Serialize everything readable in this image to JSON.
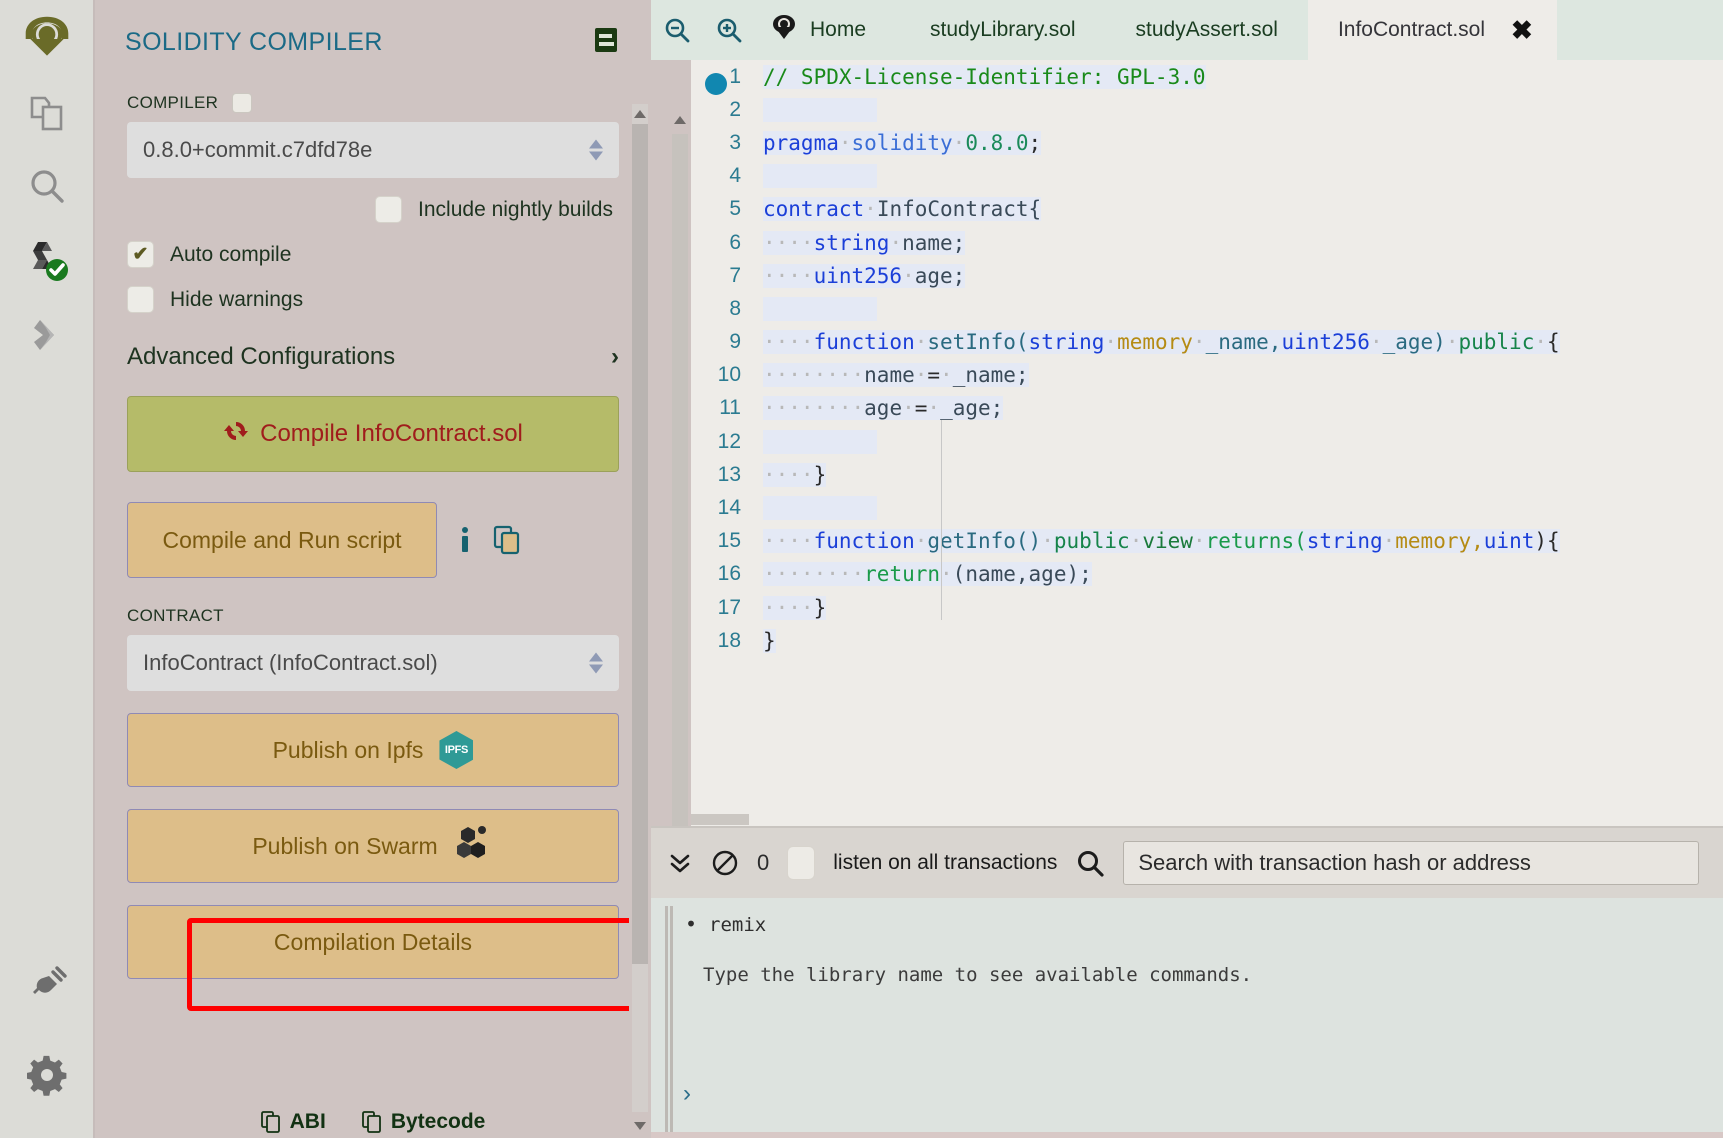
{
  "rail": {
    "items": [
      {
        "name": "remix-logo-icon",
        "label": "Remix"
      },
      {
        "name": "file-explorer-icon",
        "label": "File explorers"
      },
      {
        "name": "search-icon",
        "label": "Search in files"
      },
      {
        "name": "solidity-compiler-icon",
        "label": "Solidity compiler"
      },
      {
        "name": "deploy-run-icon",
        "label": "Deploy & run transactions"
      }
    ],
    "bottom": [
      {
        "name": "plugin-manager-icon",
        "label": "Plugin manager"
      },
      {
        "name": "settings-gear-icon",
        "label": "Settings"
      }
    ]
  },
  "sidebar": {
    "title": "SOLIDITY COMPILER",
    "doc_icon": "documentation-icon",
    "compiler_label": "COMPILER",
    "compiler_version": "0.8.0+commit.c7dfd78e",
    "nightly_label": "Include nightly builds",
    "auto_compile_label": "Auto compile",
    "auto_compile_checked": "✔",
    "hide_warnings_label": "Hide warnings",
    "advanced_label": "Advanced Configurations",
    "advanced_chevron": "›",
    "compile_button": "Compile InfoContract.sol",
    "compile_icon": "sync-refresh-icon",
    "run_script_button": "Compile and Run script",
    "info_icon": "info-icon",
    "copy_icon": "copy-icon",
    "contract_label": "CONTRACT",
    "contract_value": "InfoContract (InfoContract.sol)",
    "publish_ipfs_button": "Publish on Ipfs",
    "ipfs_badge": "IPFS",
    "publish_swarm_button": "Publish on Swarm",
    "compilation_details_button": "Compilation Details",
    "abi_label": "ABI",
    "bytecode_label": "Bytecode",
    "highlight_color": "#ff0000",
    "accent_color": "#1b6a86"
  },
  "tabbar": {
    "zoom_out_icon": "zoom-out-icon",
    "zoom_in_icon": "zoom-in-icon",
    "tabs": [
      {
        "label": "Home",
        "icon": "remix-home-icon",
        "active": false,
        "closable": false
      },
      {
        "label": "studyLibrary.sol",
        "icon": "",
        "active": false,
        "closable": false
      },
      {
        "label": "studyAssert.sol",
        "icon": "",
        "active": false,
        "closable": false
      },
      {
        "label": "InfoContract.sol",
        "icon": "",
        "active": true,
        "closable": true,
        "close_glyph": "✖"
      }
    ]
  },
  "editor": {
    "breakpoint_line": 1,
    "lines": [
      {
        "n": "1",
        "tokens": [
          {
            "t": "// SPDX-License-Identifier: GPL-3.0",
            "c": "k-com"
          }
        ]
      },
      {
        "n": "2",
        "tokens": []
      },
      {
        "n": "3",
        "tokens": [
          {
            "t": "pragma",
            "c": "k-kw"
          },
          {
            "t": " ",
            "c": "ws"
          },
          {
            "t": "solidity",
            "c": "k-kw2"
          },
          {
            "t": " ",
            "c": "ws"
          },
          {
            "t": "0.8.0",
            "c": "k-num"
          },
          {
            "t": ";",
            "c": "k-pl"
          }
        ]
      },
      {
        "n": "4",
        "tokens": []
      },
      {
        "n": "5",
        "tokens": [
          {
            "t": "contract",
            "c": "k-kw"
          },
          {
            "t": " ",
            "c": "ws"
          },
          {
            "t": "InfoContract{",
            "c": "k-id"
          }
        ]
      },
      {
        "n": "6",
        "tokens": [
          {
            "t": "    ",
            "c": "ws"
          },
          {
            "t": "string",
            "c": "k-typ"
          },
          {
            "t": " ",
            "c": "ws"
          },
          {
            "t": "name;",
            "c": "k-id"
          }
        ]
      },
      {
        "n": "7",
        "tokens": [
          {
            "t": "    ",
            "c": "ws"
          },
          {
            "t": "uint256",
            "c": "k-typ"
          },
          {
            "t": " ",
            "c": "ws"
          },
          {
            "t": "age;",
            "c": "k-id"
          }
        ]
      },
      {
        "n": "8",
        "tokens": []
      },
      {
        "n": "9",
        "tokens": [
          {
            "t": "    ",
            "c": "ws"
          },
          {
            "t": "function",
            "c": "k-kw"
          },
          {
            "t": " ",
            "c": "ws"
          },
          {
            "t": "setInfo(",
            "c": "k-fn"
          },
          {
            "t": "string",
            "c": "k-typ"
          },
          {
            "t": " ",
            "c": "ws"
          },
          {
            "t": "memory",
            "c": "k-mem"
          },
          {
            "t": " ",
            "c": "ws"
          },
          {
            "t": "_name,",
            "c": "k-fn"
          },
          {
            "t": "uint256",
            "c": "k-typ"
          },
          {
            "t": " ",
            "c": "ws"
          },
          {
            "t": "_age)",
            "c": "k-fn"
          },
          {
            "t": " ",
            "c": "ws"
          },
          {
            "t": "public",
            "c": "k-pub"
          },
          {
            "t": " ",
            "c": "ws"
          },
          {
            "t": "{",
            "c": "k-pl"
          }
        ]
      },
      {
        "n": "10",
        "tokens": [
          {
            "t": "        ",
            "c": "ws"
          },
          {
            "t": "name",
            "c": "k-id"
          },
          {
            "t": " ",
            "c": "ws"
          },
          {
            "t": "=",
            "c": "k-pl"
          },
          {
            "t": " ",
            "c": "ws"
          },
          {
            "t": "_name;",
            "c": "k-id"
          }
        ]
      },
      {
        "n": "11",
        "tokens": [
          {
            "t": "        ",
            "c": "ws"
          },
          {
            "t": "age",
            "c": "k-id"
          },
          {
            "t": " ",
            "c": "ws"
          },
          {
            "t": "=",
            "c": "k-pl"
          },
          {
            "t": " ",
            "c": "ws"
          },
          {
            "t": "_age;",
            "c": "k-id"
          }
        ]
      },
      {
        "n": "12",
        "tokens": []
      },
      {
        "n": "13",
        "tokens": [
          {
            "t": "    ",
            "c": "ws"
          },
          {
            "t": "}",
            "c": "k-pl"
          }
        ]
      },
      {
        "n": "14",
        "tokens": []
      },
      {
        "n": "15",
        "tokens": [
          {
            "t": "    ",
            "c": "ws"
          },
          {
            "t": "function",
            "c": "k-kw"
          },
          {
            "t": " ",
            "c": "ws"
          },
          {
            "t": "getInfo()",
            "c": "k-fn"
          },
          {
            "t": " ",
            "c": "ws"
          },
          {
            "t": "public",
            "c": "k-pub"
          },
          {
            "t": " ",
            "c": "ws"
          },
          {
            "t": "view",
            "c": "k-vw"
          },
          {
            "t": " ",
            "c": "ws"
          },
          {
            "t": "returns(",
            "c": "k-ret"
          },
          {
            "t": "string",
            "c": "k-typ"
          },
          {
            "t": " ",
            "c": "ws"
          },
          {
            "t": "memory,",
            "c": "k-mem"
          },
          {
            "t": "uint",
            "c": "k-typ"
          },
          {
            "t": "){",
            "c": "k-pl"
          }
        ]
      },
      {
        "n": "16",
        "tokens": [
          {
            "t": "        ",
            "c": "ws"
          },
          {
            "t": "return",
            "c": "k-ret"
          },
          {
            "t": " ",
            "c": "ws"
          },
          {
            "t": "(name,age);",
            "c": "k-id"
          }
        ]
      },
      {
        "n": "17",
        "tokens": [
          {
            "t": "    ",
            "c": "ws"
          },
          {
            "t": "}",
            "c": "k-pl"
          }
        ]
      },
      {
        "n": "18",
        "tokens": [
          {
            "t": "}",
            "c": "k-pl"
          }
        ]
      }
    ]
  },
  "terminal": {
    "collapse_icon": "chevron-double-down-icon",
    "clear_icon": "block-clear-icon",
    "count": "0",
    "listen_label": "listen on all transactions",
    "search_icon": "search-icon",
    "search_placeholder": "Search with transaction hash or address",
    "log_bullet": "•",
    "log_text": "remix",
    "hint_text": "Type the library name to see available commands.",
    "prompt": "›"
  }
}
